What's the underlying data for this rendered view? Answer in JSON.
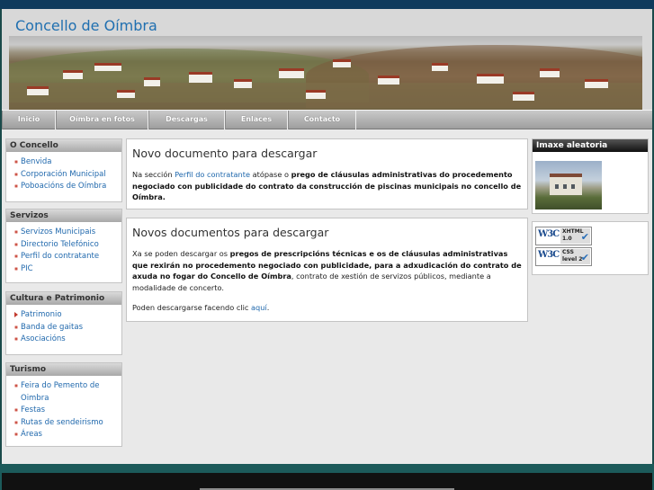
{
  "site": {
    "title": "Concello de Oímbra"
  },
  "nav": [
    {
      "label": "Inicio"
    },
    {
      "label": "Oímbra en fotos"
    },
    {
      "label": "Descargas"
    },
    {
      "label": "Enlaces"
    },
    {
      "label": "Contacto"
    }
  ],
  "sidebar": {
    "sections": [
      {
        "title": "O Concello",
        "items": [
          "Benvida",
          "Corporación Municipal",
          "Poboacións de Oímbra"
        ]
      },
      {
        "title": "Servizos",
        "items": [
          "Servizos Municipais",
          "Directorio Telefónico",
          "Perfil do contratante",
          "PIC"
        ]
      },
      {
        "title": "Cultura e Patrimonio",
        "items": [
          "Patrimonio",
          "Banda de gaitas",
          "Asociacións"
        ]
      },
      {
        "title": "Turismo",
        "items": [
          "Feira do Pemento de Oimbra",
          "Festas",
          "Rutas de sendeirismo",
          "Áreas"
        ]
      }
    ]
  },
  "posts": [
    {
      "title": "Novo documento para descargar",
      "p1_a": "Na sección ",
      "p1_link": "Perfil do contratante",
      "p1_b": " atópase o ",
      "p1_bold": "prego de cláusulas administrativas do procedemento negociado con publicidade do contrato da construcción de piscinas municipais no concello de Oímbra."
    },
    {
      "title": "Novos documentos para descargar",
      "p1_a": "Xa se poden descargar os ",
      "p1_bold": "pregos de prescripcións técnicas e os de cláusulas administrativas que rexirán no procedemento negociado con publicidade, para a adxudicación do contrato de axuda no fogar do Concello de Oímbra",
      "p1_b": ", contrato de xestión de servizos públicos, mediante a modalidade de concerto.",
      "p2_a": "Poden descargarse facendo clic ",
      "p2_link": "aquí",
      "p2_b": "."
    }
  ],
  "right": {
    "random_image_title": "Imaxe aleatoria",
    "badges": [
      {
        "logo": "W3C",
        "label_line1": "XHTML",
        "label_line2": "1.0"
      },
      {
        "logo": "W3C",
        "label_line1": "CSS",
        "label_line2": "level 2"
      }
    ]
  },
  "colors": {
    "link": "#2169ad",
    "title": "#1f6fb0",
    "bullet": "#c23a2e"
  }
}
